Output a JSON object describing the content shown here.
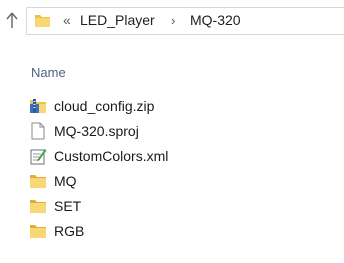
{
  "addressbar": {
    "up_icon": "up-arrow-icon",
    "folder_icon": "folder-icon",
    "overflow_chevron": "«",
    "breadcrumbs": [
      "LED_Player",
      "MQ-320"
    ],
    "separator": "›"
  },
  "columns": {
    "name_header": "Name"
  },
  "files": [
    {
      "name": "cloud_config.zip",
      "icon": "zip-archive-icon"
    },
    {
      "name": "MQ-320.sproj",
      "icon": "document-icon"
    },
    {
      "name": "CustomColors.xml",
      "icon": "xml-file-icon"
    },
    {
      "name": "MQ",
      "icon": "folder-icon"
    },
    {
      "name": "SET",
      "icon": "folder-icon"
    },
    {
      "name": "RGB",
      "icon": "folder-icon"
    }
  ],
  "colors": {
    "folder": "#f0c24b",
    "header_text": "#4d6082",
    "zip_blue": "#3d6fbf"
  }
}
